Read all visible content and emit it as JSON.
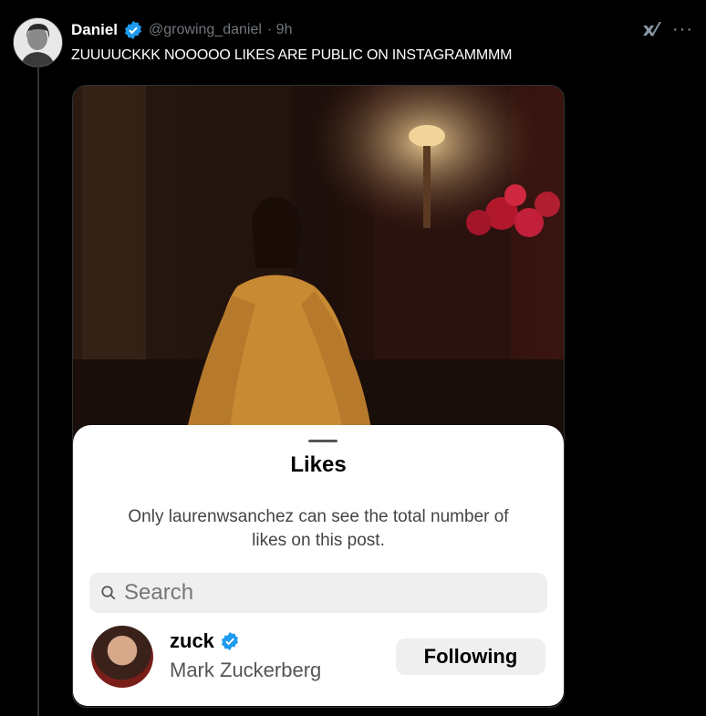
{
  "tweet": {
    "author_name": "Daniel",
    "handle": "@growing_daniel",
    "time": "· 9h",
    "text": "ZUUUUCKKK NOOOOO LIKES ARE PUBLIC ON INSTAGRAMMMM"
  },
  "sheet": {
    "title": "Likes",
    "note": "Only laurenwsanchez can see the total number of likes on this post.",
    "search_placeholder": "Search",
    "like": {
      "username": "zuck",
      "full_name": "Mark Zuckerberg",
      "button_label": "Following"
    }
  },
  "colors": {
    "background": "#000000",
    "verified": "#1d9bf0",
    "sheet_bg": "#ffffff"
  }
}
